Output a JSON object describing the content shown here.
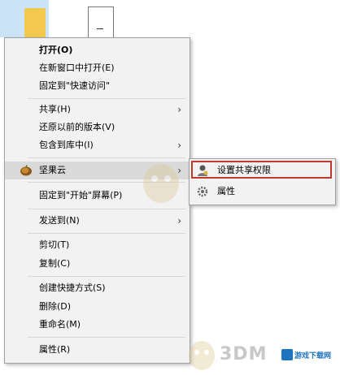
{
  "context_menu": {
    "items": [
      {
        "label": "打开(O)",
        "bold": true
      },
      {
        "label": "在新窗口中打开(E)"
      },
      {
        "label": "固定到\"快速访问\""
      },
      {
        "label": "共享(H)",
        "submenu": true
      },
      {
        "label": "还原以前的版本(V)"
      },
      {
        "label": "包含到库中(I)",
        "submenu": true
      },
      {
        "label": "坚果云",
        "submenu": true,
        "icon": "nutstore-icon",
        "active": true
      },
      {
        "label": "固定到\"开始\"屏幕(P)"
      },
      {
        "label": "发送到(N)",
        "submenu": true
      },
      {
        "label": "剪切(T)"
      },
      {
        "label": "复制(C)"
      },
      {
        "label": "创建快捷方式(S)"
      },
      {
        "label": "删除(D)"
      },
      {
        "label": "重命名(M)"
      },
      {
        "label": "属性(R)"
      }
    ]
  },
  "submenu": {
    "items": [
      {
        "label": "设置共享权限",
        "icon": "share-permission-icon",
        "highlighted": true
      },
      {
        "label": "属性",
        "icon": "gear-icon"
      }
    ]
  },
  "watermark": {
    "brand": "3DM",
    "site": "游戏下载网"
  },
  "colors": {
    "menu_bg": "#f2f2f2",
    "hover_bg": "#dadada",
    "highlight_border": "#c0392b",
    "selection_bg": "#cce4f7"
  }
}
